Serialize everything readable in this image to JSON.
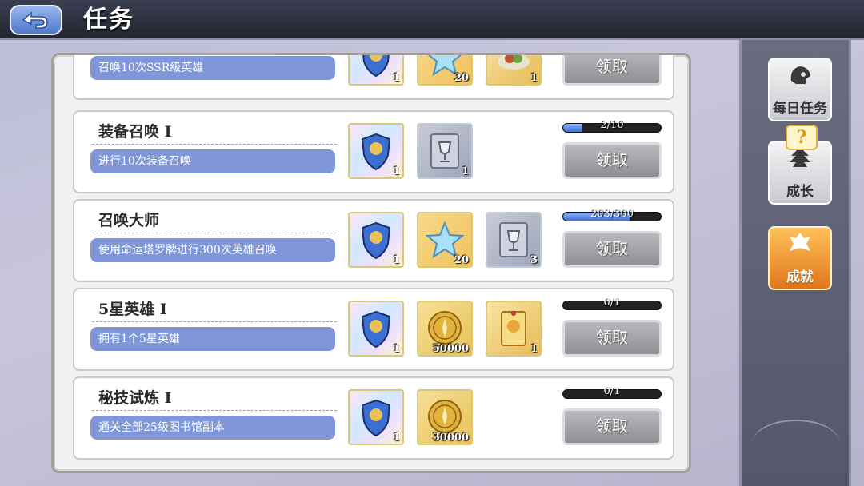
{
  "header": {
    "title": "任务"
  },
  "rail": {
    "tabs": [
      {
        "label": "每日任务",
        "icon": "helmet-icon"
      },
      {
        "label": "成长",
        "icon": "tree-icon"
      },
      {
        "label": "成就",
        "icon": "crest-icon"
      }
    ],
    "badge": "?"
  },
  "tasks": [
    {
      "title": "",
      "desc": "召唤10次SSR级英雄",
      "rewards": [
        {
          "icon": "shield-icon",
          "count": "1"
        },
        {
          "icon": "star-icon",
          "count": "20"
        },
        {
          "icon": "food-icon",
          "count": "1"
        }
      ],
      "claim": "领取"
    },
    {
      "title": "装备召唤 Ⅰ",
      "desc": "进行10次装备召唤",
      "rewards": [
        {
          "icon": "shield-icon",
          "count": "1"
        },
        {
          "icon": "cup-icon",
          "count": "1"
        }
      ],
      "progress": "2/10",
      "progress_fraction": 0.2,
      "claim": "领取"
    },
    {
      "title": "召唤大师",
      "desc": "使用命运塔罗牌进行300次英雄召唤",
      "rewards": [
        {
          "icon": "shield-icon",
          "count": "1"
        },
        {
          "icon": "star-icon",
          "count": "20"
        },
        {
          "icon": "cup-icon",
          "count": "3"
        }
      ],
      "progress": "203/300",
      "progress_fraction": 0.677,
      "claim": "领取"
    },
    {
      "title": "5星英雄 Ⅰ",
      "desc": "拥有1个5星英雄",
      "rewards": [
        {
          "icon": "shield-icon",
          "count": "1"
        },
        {
          "icon": "coin-icon",
          "count": "50000"
        },
        {
          "icon": "card-icon",
          "count": "1"
        }
      ],
      "progress": "0/1",
      "progress_fraction": 0,
      "claim": "领取"
    },
    {
      "title": "秘技试炼 Ⅰ",
      "desc": "通关全部25级图书馆副本",
      "rewards": [
        {
          "icon": "shield-icon",
          "count": "1"
        },
        {
          "icon": "coin-icon",
          "count": "30000"
        }
      ],
      "progress": "0/1",
      "progress_fraction": 0,
      "claim": "领取"
    }
  ]
}
